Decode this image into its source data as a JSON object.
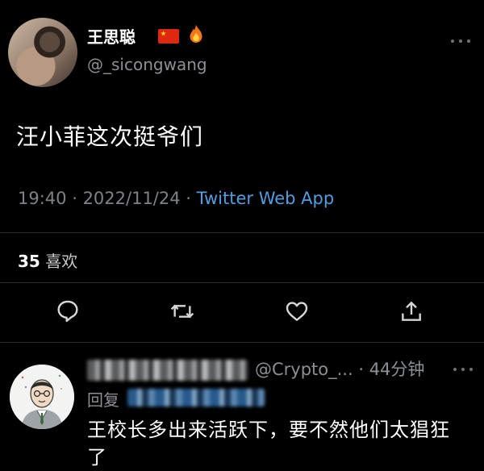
{
  "tweet": {
    "display_name": "王思聪",
    "badges": [
      "china-flag-icon",
      "fire-icon"
    ],
    "handle": "@_sicongwang",
    "text": "汪小菲这次挺爷们",
    "time": "19:40",
    "date": "2022/11/24",
    "separator": " · ",
    "source": "Twitter Web App",
    "likes_count": "35",
    "likes_label": "喜欢",
    "actions": [
      "reply-icon",
      "retweet-icon",
      "like-icon",
      "share-icon"
    ]
  },
  "reply": {
    "handle_and_time": "@Crypto_... · 44分钟",
    "reply_to_label": "回复",
    "text": "王校长多出来活跃下，要不然他们太猖狂了"
  },
  "colors": {
    "background": "#000000",
    "link": "#4f9ee0",
    "muted_text": "#8b9096"
  }
}
